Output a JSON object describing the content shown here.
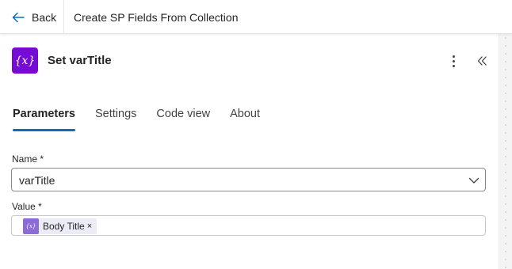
{
  "topbar": {
    "back_label": "Back",
    "flow_title": "Create SP Fields From Collection"
  },
  "action": {
    "icon_glyph": "{x}",
    "icon_name": "variable-icon",
    "title": "Set varTitle"
  },
  "tabs": [
    {
      "label": "Parameters",
      "active": true
    },
    {
      "label": "Settings",
      "active": false
    },
    {
      "label": "Code view",
      "active": false
    },
    {
      "label": "About",
      "active": false
    }
  ],
  "fields": {
    "name_label": "Name *",
    "name_value": "varTitle",
    "value_label": "Value *",
    "value_token": {
      "icon_glyph": "{x}",
      "label": "Body Title",
      "remove": "×"
    }
  },
  "colors": {
    "action_icon": "#770bd6",
    "token_icon": "#8c6cd8",
    "token_bg": "#ececf7",
    "tab_accent": "#0f6cbd"
  }
}
